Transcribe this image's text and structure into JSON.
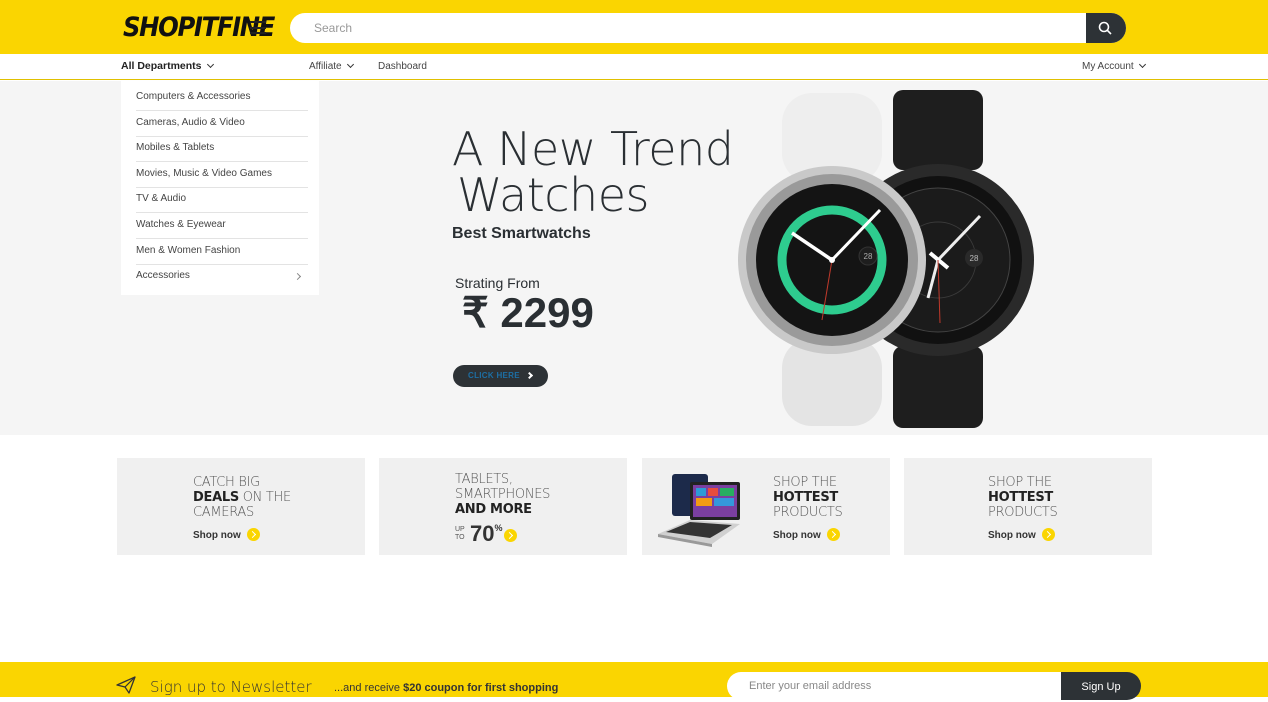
{
  "header": {
    "logo": "SHOPITFINE",
    "search": {
      "placeholder": "Search"
    }
  },
  "nav": {
    "departments_label": "All Departments",
    "affiliate_label": "Affiliate",
    "dashboard_label": "Dashboard",
    "account_label": "My Account"
  },
  "departments": [
    {
      "label": "Computers & Accessories"
    },
    {
      "label": "Cameras, Audio & Video"
    },
    {
      "label": "Mobiles & Tablets"
    },
    {
      "label": "Movies, Music & Video Games"
    },
    {
      "label": "TV & Audio"
    },
    {
      "label": "Watches & Eyewear"
    },
    {
      "label": "Men & Women Fashion"
    },
    {
      "label": "Accessories"
    }
  ],
  "hero": {
    "title_line1": "A New Trend",
    "title_line2": "Watches",
    "subtitle": "Best Smartwatchs",
    "from_label": "Strating From",
    "price": "₹ 2299",
    "cta": "CLICK HERE",
    "watch1_date": "28",
    "watch2_date": "28"
  },
  "promos": [
    {
      "line1": "CATCH BIG",
      "bold": "DEALS",
      "line2_rest": " ON THE",
      "line3": "CAMERAS",
      "shop": "Shop now"
    },
    {
      "line1": "TABLETS,",
      "line2": "SMARTPHONES",
      "bold": "AND MORE",
      "upto1": "UP",
      "upto2": "TO",
      "percent": "70",
      "percent_sign": "%"
    },
    {
      "line1": "SHOP THE",
      "bold": "HOTTEST",
      "line3": "PRODUCTS",
      "shop": "Shop now"
    },
    {
      "line1": "SHOP THE",
      "bold": "HOTTEST",
      "line3": "PRODUCTS",
      "shop": "Shop now"
    }
  ],
  "newsletter": {
    "title": "Sign up to Newsletter",
    "text_prefix": "...and receive ",
    "text_bold": "$20 coupon for first shopping",
    "email_placeholder": "Enter your email address",
    "button": "Sign Up"
  },
  "colors": {
    "brand_yellow": "#fad501",
    "dark": "#2d3236",
    "hero_bg": "#f5f5f5"
  }
}
